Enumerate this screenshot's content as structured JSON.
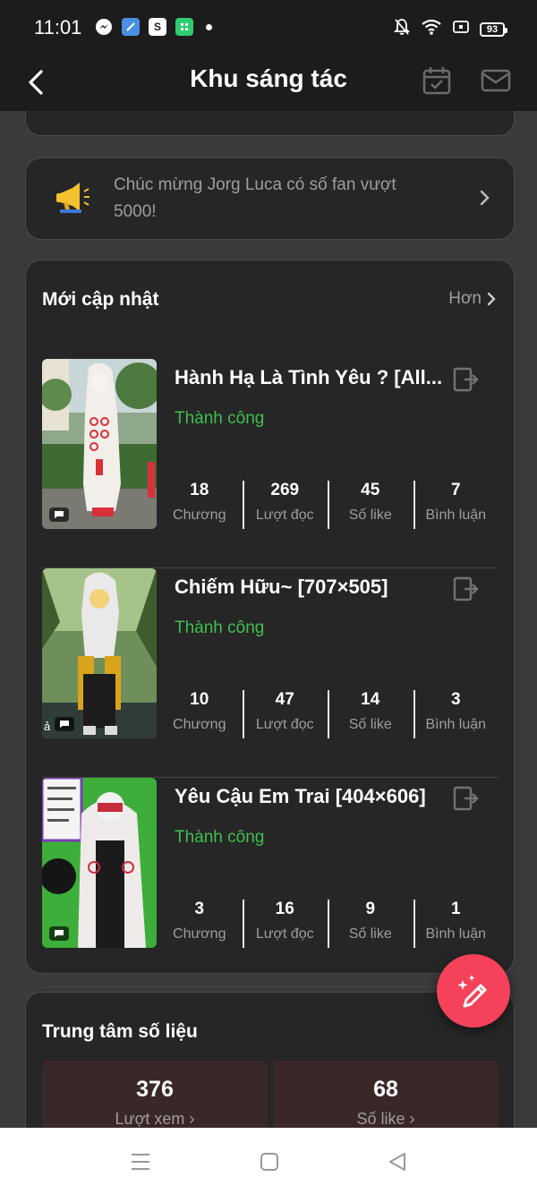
{
  "status_bar": {
    "time": "11:01",
    "battery": "93"
  },
  "header": {
    "title": "Khu sáng tác"
  },
  "notice": {
    "text": "Chúc mừng Jorg Luca có số fan vượt 5000!"
  },
  "updates": {
    "title": "Mới cập nhật",
    "more_label": "Hơn",
    "stories": [
      {
        "title": "Hành Hạ Là Tình Yêu ? [All...",
        "status": "Thành công",
        "thumb_note": "",
        "stats": [
          {
            "value": "18",
            "label": "Chương"
          },
          {
            "value": "269",
            "label": "Lượt đọc"
          },
          {
            "value": "45",
            "label": "Số like"
          },
          {
            "value": "7",
            "label": "Bình luận"
          }
        ]
      },
      {
        "title": "Chiếm Hữu~ [707×505]",
        "status": "Thành công",
        "thumb_note": "ả",
        "stats": [
          {
            "value": "10",
            "label": "Chương"
          },
          {
            "value": "47",
            "label": "Lượt đọc"
          },
          {
            "value": "14",
            "label": "Số like"
          },
          {
            "value": "3",
            "label": "Bình luận"
          }
        ]
      },
      {
        "title": "Yêu Cậu Em Trai [404×606]",
        "status": "Thành công",
        "thumb_note": "",
        "stats": [
          {
            "value": "3",
            "label": "Chương"
          },
          {
            "value": "16",
            "label": "Lượt đọc"
          },
          {
            "value": "9",
            "label": "Số like"
          },
          {
            "value": "1",
            "label": "Bình luận"
          }
        ]
      }
    ]
  },
  "data_center": {
    "title": "Trung tâm số liệu",
    "metrics": [
      {
        "value": "376",
        "label": "Lượt xem"
      },
      {
        "value": "68",
        "label": "Số like"
      }
    ]
  },
  "colors": {
    "success": "#3fbf4e",
    "fab": "#f5415a",
    "card": "#262626",
    "background": "#3a3a3a"
  }
}
